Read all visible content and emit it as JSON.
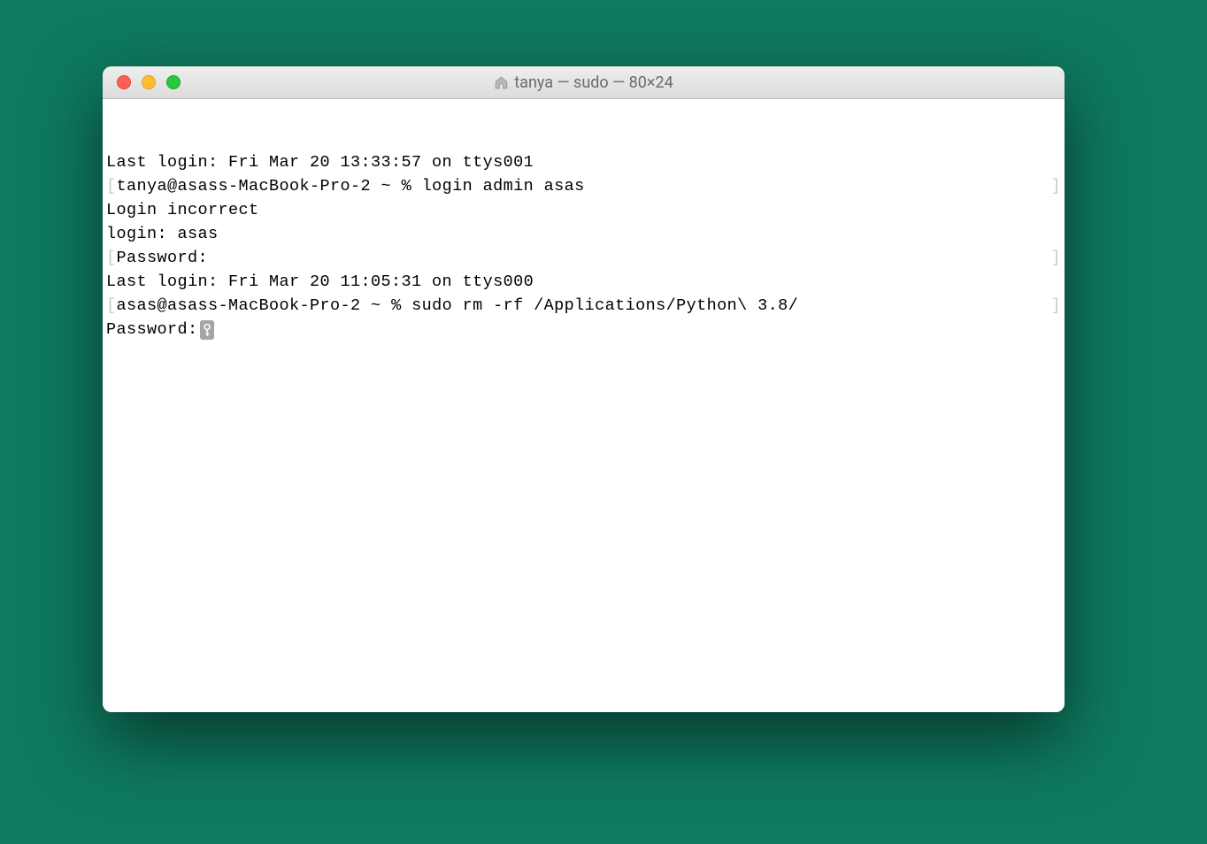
{
  "window": {
    "title": "tanya — sudo — 80×24"
  },
  "terminal": {
    "lines": [
      {
        "type": "plain",
        "text": "Last login: Fri Mar 20 13:33:57 on ttys001"
      },
      {
        "type": "bracketed",
        "text": "tanya@asass-MacBook-Pro-2 ~ % login admin asas"
      },
      {
        "type": "plain",
        "text": "Login incorrect"
      },
      {
        "type": "plain",
        "text": "login: asas"
      },
      {
        "type": "bracketed",
        "text": "Password:"
      },
      {
        "type": "plain",
        "text": "Last login: Fri Mar 20 11:05:31 on ttys000"
      },
      {
        "type": "bracketed",
        "text": "asas@asass-MacBook-Pro-2 ~ % sudo rm -rf /Applications/Python\\ 3.8/"
      },
      {
        "type": "password",
        "text": "Password:"
      }
    ]
  }
}
